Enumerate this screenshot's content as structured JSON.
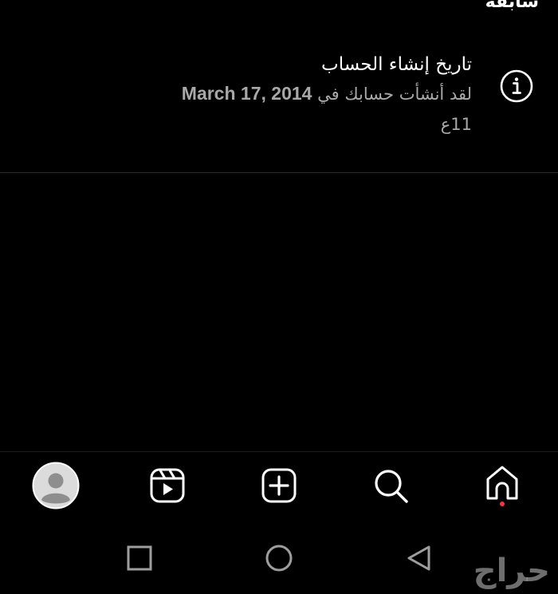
{
  "header": {
    "cut_title": "سابقة"
  },
  "info_row": {
    "icon": "info-icon",
    "title": "تاريخ إنشاء الحساب",
    "subtitle_prefix": "لقد أنشأت حسابك في",
    "date": "March 17, 2014",
    "age": "11ع"
  },
  "bottom_nav": {
    "items": [
      {
        "name": "profile",
        "icon": "avatar-icon"
      },
      {
        "name": "reels",
        "icon": "reels-icon"
      },
      {
        "name": "create",
        "icon": "plus-square-icon"
      },
      {
        "name": "search",
        "icon": "search-icon"
      },
      {
        "name": "home",
        "icon": "home-icon",
        "notification_dot_color": "#ff3040"
      }
    ]
  },
  "system_nav": {
    "items": [
      {
        "name": "recents",
        "icon": "square-icon"
      },
      {
        "name": "home",
        "icon": "circle-icon"
      },
      {
        "name": "back",
        "icon": "triangle-back-icon"
      }
    ]
  },
  "watermark": {
    "text": "حراج"
  },
  "colors": {
    "background": "#000000",
    "primary_text": "#ffffff",
    "secondary_text": "#a8a8a8",
    "notification_dot": "#ff3040"
  }
}
